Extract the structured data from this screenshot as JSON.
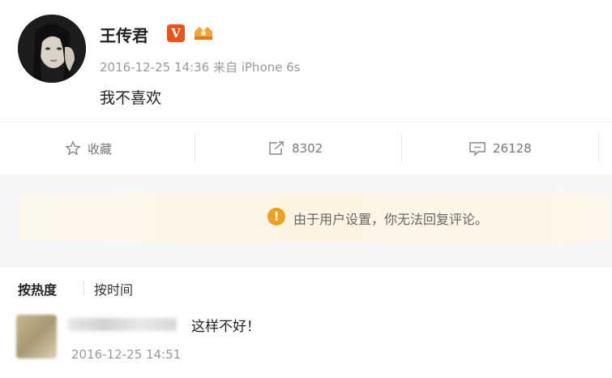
{
  "post": {
    "username": "王传君",
    "verified_badge": "V",
    "member_icon": "member-crown-icon",
    "timestamp": "2016-12-25 14:36",
    "source": "来自 iPhone 6s",
    "content": "我不喜欢"
  },
  "actions": {
    "favorite_label": "收藏",
    "favorite_icon": "star-icon",
    "repost_count": "8302",
    "repost_icon": "repost-icon",
    "comment_count": "26128",
    "comment_icon": "comment-icon"
  },
  "notice": {
    "icon": "warning-icon",
    "text": "由于用户设置，你无法回复评论。"
  },
  "comments": {
    "sort_hot": "按热度",
    "sort_time": "按时间",
    "items": [
      {
        "text": "这样不好！",
        "time": "2016-12-25 14:51"
      }
    ]
  },
  "colors": {
    "verified": "#e8541e",
    "warning": "#f0a020",
    "notice_bg": "#fcf3e2"
  }
}
